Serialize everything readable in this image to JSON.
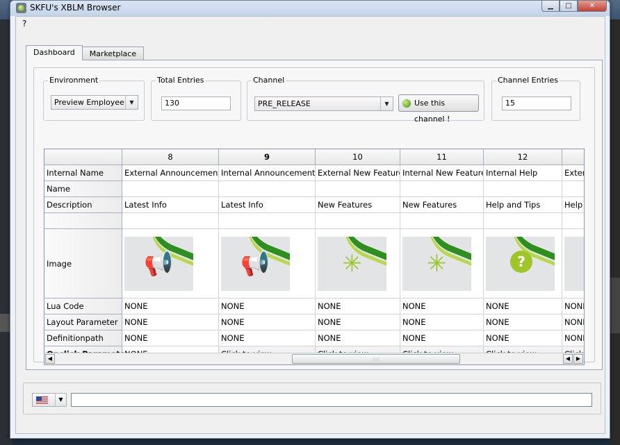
{
  "window": {
    "title": "SKFU's XBLM Browser",
    "min_label": "▁",
    "max_label": "□",
    "close_label": "✕"
  },
  "menu": {
    "items": [
      "?"
    ]
  },
  "tabs": [
    "Dashboard",
    "Marketplace"
  ],
  "environment": {
    "label": "Environment",
    "value": "Preview Employee"
  },
  "total_entries": {
    "label": "Total Entries",
    "value": "130"
  },
  "channel": {
    "label": "Channel",
    "value": "PRE_RELEASE",
    "button": "Use this channel !"
  },
  "channel_entries": {
    "label": "Channel Entries",
    "value": "15"
  },
  "table": {
    "columns": [
      "8",
      "9",
      "10",
      "11",
      "12",
      ""
    ],
    "row_headers": [
      "Internal Name",
      "Name",
      "Description",
      "",
      "Image",
      "Lua Code",
      "Layout Parameter",
      "Definitionpath",
      "Onclick Parameter"
    ],
    "rows": {
      "internal_name": [
        "External Announcements",
        "Internal Announcements",
        "External New Features",
        "Internal New Features",
        "Internal Help",
        "Extern"
      ],
      "name": [
        "",
        "",
        "",
        "",
        "",
        ""
      ],
      "description": [
        "Latest Info",
        "Latest Info",
        "New Features",
        "New Features",
        "Help and Tips",
        "Help"
      ],
      "blank": [
        "",
        "",
        "",
        "",
        "",
        ""
      ],
      "image": [
        "megaphone",
        "megaphone",
        "sparkle",
        "sparkle",
        "question",
        "blank"
      ],
      "lua_code": [
        "NONE",
        "NONE",
        "NONE",
        "NONE",
        "NONE",
        "NONI"
      ],
      "layout_parameter": [
        "NONE",
        "NONE",
        "NONE",
        "NONE",
        "NONE",
        "NONI"
      ],
      "definitionpath": [
        "NONE",
        "NONE",
        "NONE",
        "NONE",
        "NONE",
        "NONI"
      ],
      "onclick_parameter": [
        "NONE",
        "Click to view",
        "Click to view",
        "Click to view",
        "Click to view",
        "Click"
      ]
    },
    "scroll_left": "◀",
    "scroll_right": "▶",
    "scroll_grip": "::::"
  },
  "icons": {
    "megaphone": "📢",
    "sparkle": "✳",
    "question": "?"
  },
  "colors": {
    "accent_green": "#9ec62a",
    "stripe_green": "#2f8f1e"
  },
  "bottom": {
    "locale": "en-US",
    "command_value": ""
  }
}
